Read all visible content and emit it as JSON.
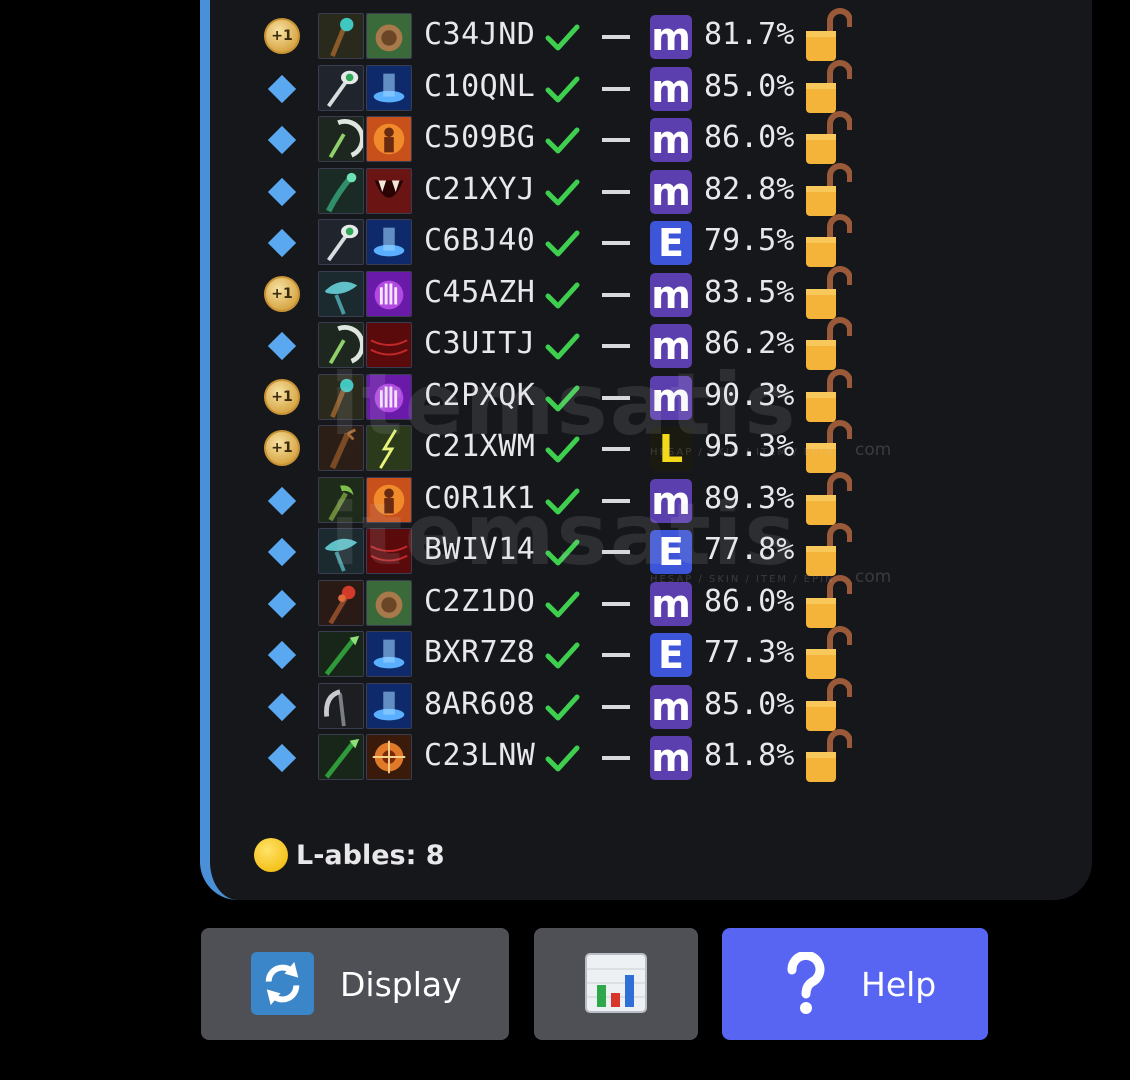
{
  "rows": [
    {
      "marker": "bonus",
      "bonus_label": "+1",
      "code": "C34JND",
      "grade": "m",
      "grade_color": "purple",
      "pct": "81.7%",
      "tile1": "staff-orb-icon",
      "tile2": "bear-claw-icon"
    },
    {
      "marker": "diamond",
      "code": "C10QNL",
      "grade": "m",
      "grade_color": "purple",
      "pct": "85.0%",
      "tile1": "eye-staff-icon",
      "tile2": "blue-portal-icon"
    },
    {
      "marker": "diamond",
      "code": "C509BG",
      "grade": "m",
      "grade_color": "purple",
      "pct": "86.0%",
      "tile1": "crescent-staff-icon",
      "tile2": "fire-figure-icon"
    },
    {
      "marker": "diamond",
      "code": "C21XYJ",
      "grade": "m",
      "grade_color": "purple",
      "pct": "82.8%",
      "tile1": "serpent-staff-icon",
      "tile2": "fang-mouth-icon"
    },
    {
      "marker": "diamond",
      "code": "C6BJ40",
      "grade": "E",
      "grade_color": "blue",
      "pct": "79.5%",
      "tile1": "eye-staff-icon",
      "tile2": "blue-portal-icon"
    },
    {
      "marker": "bonus",
      "bonus_label": "+1",
      "code": "C45AZH",
      "grade": "m",
      "grade_color": "purple",
      "pct": "83.5%",
      "tile1": "fish-staff-icon",
      "tile2": "purple-hand-icon"
    },
    {
      "marker": "diamond",
      "code": "C3UITJ",
      "grade": "m",
      "grade_color": "purple",
      "pct": "86.2%",
      "tile1": "crescent-staff-icon",
      "tile2": "red-web-icon"
    },
    {
      "marker": "bonus",
      "bonus_label": "+1",
      "code": "C2PXQK",
      "grade": "m",
      "grade_color": "purple",
      "pct": "90.3%",
      "tile1": "staff-orb-icon",
      "tile2": "purple-hand-icon"
    },
    {
      "marker": "bonus",
      "bonus_label": "+1",
      "code": "C21XWM",
      "grade": "L",
      "grade_color": "yellow",
      "pct": "95.3%",
      "tile1": "root-staff-icon",
      "tile2": "lightning-icon"
    },
    {
      "marker": "diamond",
      "code": "C0R1K1",
      "grade": "m",
      "grade_color": "purple",
      "pct": "89.3%",
      "tile1": "green-claw-icon",
      "tile2": "fire-figure-icon"
    },
    {
      "marker": "diamond",
      "code": "BWIV14",
      "grade": "E",
      "grade_color": "blue",
      "pct": "77.8%",
      "tile1": "fish-staff-icon",
      "tile2": "red-web-icon"
    },
    {
      "marker": "diamond",
      "code": "C2Z1DO",
      "grade": "m",
      "grade_color": "purple",
      "pct": "86.0%",
      "tile1": "fire-staff-icon",
      "tile2": "bear-claw-icon"
    },
    {
      "marker": "diamond",
      "code": "BXR7Z8",
      "grade": "E",
      "grade_color": "blue",
      "pct": "77.3%",
      "tile1": "green-spear-icon",
      "tile2": "blue-portal-icon"
    },
    {
      "marker": "diamond",
      "code": "8AR608",
      "grade": "m",
      "grade_color": "purple",
      "pct": "85.0%",
      "tile1": "scythe-icon",
      "tile2": "blue-portal-icon"
    },
    {
      "marker": "diamond",
      "code": "C23LNW",
      "grade": "m",
      "grade_color": "purple",
      "pct": "81.8%",
      "tile1": "green-spear-icon",
      "tile2": "target-orb-icon"
    }
  ],
  "footer": {
    "text": "L-ables: 8"
  },
  "buttons": {
    "display": "Display",
    "help": "Help"
  },
  "colors": {
    "accent_bar": "#4a90d9",
    "help_button": "#5865f2",
    "grade_purple": "#5b3fae",
    "grade_blue": "#3d55d8",
    "grade_yellow": "#f2da1a"
  },
  "watermark": {
    "brand": "itemsatis",
    "sub": "HESAP / SKIN / ITEM / EPIN",
    "domain": "com"
  }
}
